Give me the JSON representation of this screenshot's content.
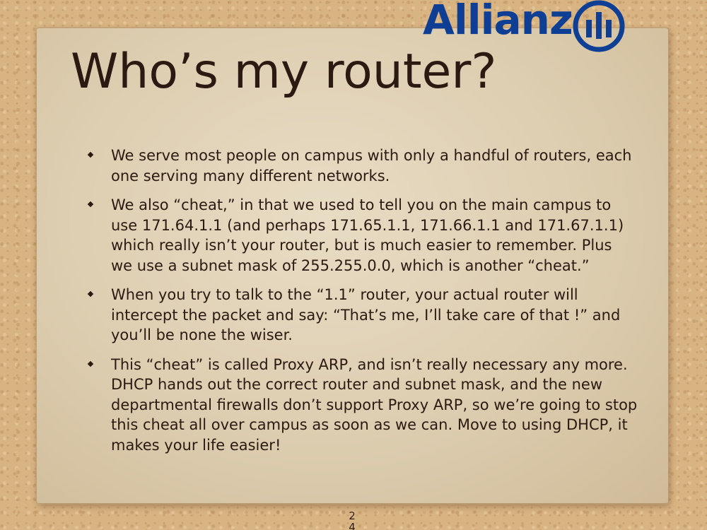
{
  "logo": {
    "text": "Allianz",
    "icon": "allianz-eagle-icon",
    "color": "#0f3f94"
  },
  "slide": {
    "title": "Who’s my router?",
    "bullets": [
      "We serve most people on campus with only a handful of routers, each one serving many different networks.",
      "We also “cheat,” in that we used to tell you on the main campus to use 171.64.1.1 (and perhaps 171.65.1.1, 171.66.1.1 and 171.67.1.1) which really isn’t your router, but is much easier to remember. Plus we use a subnet mask of 255.255.0.0, which is another “cheat.”",
      "When you try to talk to the “1.1” router, your actual router will intercept the packet and say: “That’s me, I’ll take care of that !” and you’ll be none the wiser.",
      "This “cheat” is called Proxy ARP, and isn’t really necessary any more. DHCP hands out the correct router and subnet mask, and the new departmental firewalls don’t support Proxy ARP, so we’re going to stop this cheat all over campus as soon as we can. Move to using DHCP, it makes your life easier!"
    ],
    "page_number": "24"
  },
  "colors": {
    "text": "#2c1a12",
    "background": "#d9b483",
    "card": "#e3d6bc"
  }
}
